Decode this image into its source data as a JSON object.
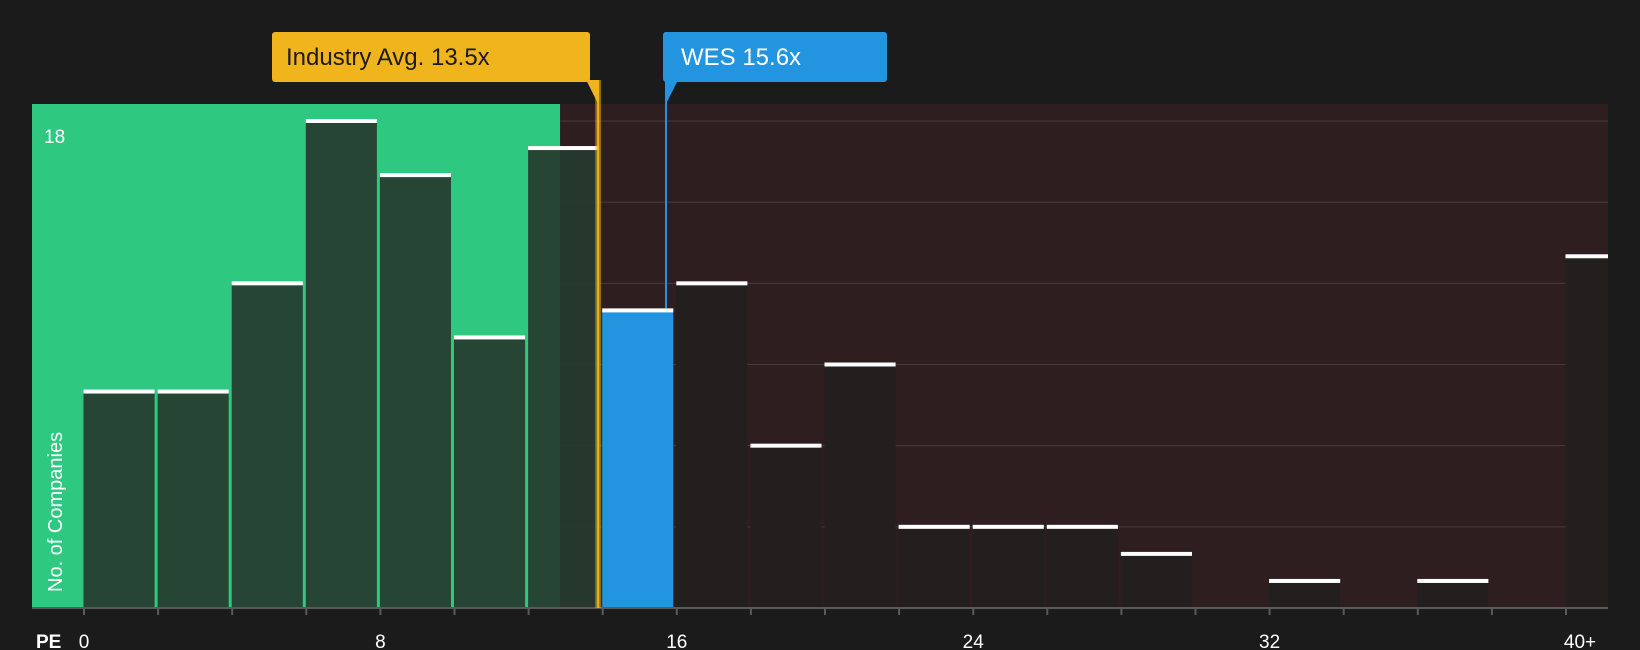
{
  "chart_data": {
    "type": "bar",
    "title": "",
    "xlabel": "PE",
    "ylabel": "No. of Companies",
    "x_tick_labels": [
      "0",
      "8",
      "16",
      "24",
      "32",
      "40+"
    ],
    "x_tick_values": [
      0,
      8,
      16,
      24,
      32,
      40
    ],
    "y_tick_labels": [
      "18"
    ],
    "y_tick_values": [
      18
    ],
    "ylim": [
      0,
      18.7
    ],
    "xlim": [
      -1.4,
      41.0
    ],
    "bin_width": 2,
    "bins": [
      {
        "start": 0,
        "end": 2,
        "value": 8
      },
      {
        "start": 2,
        "end": 4,
        "value": 8
      },
      {
        "start": 4,
        "end": 6,
        "value": 12
      },
      {
        "start": 6,
        "end": 8,
        "value": 18
      },
      {
        "start": 8,
        "end": 10,
        "value": 16
      },
      {
        "start": 10,
        "end": 12,
        "value": 10
      },
      {
        "start": 12,
        "end": 14,
        "value": 17
      },
      {
        "start": 14,
        "end": 16,
        "value": 11
      },
      {
        "start": 16,
        "end": 18,
        "value": 12
      },
      {
        "start": 18,
        "end": 20,
        "value": 6
      },
      {
        "start": 20,
        "end": 22,
        "value": 9
      },
      {
        "start": 22,
        "end": 24,
        "value": 3
      },
      {
        "start": 24,
        "end": 26,
        "value": 3
      },
      {
        "start": 26,
        "end": 28,
        "value": 3
      },
      {
        "start": 28,
        "end": 30,
        "value": 2
      },
      {
        "start": 30,
        "end": 32,
        "value": 0
      },
      {
        "start": 32,
        "end": 34,
        "value": 1
      },
      {
        "start": 34,
        "end": 36,
        "value": 0
      },
      {
        "start": 36,
        "end": 38,
        "value": 1
      },
      {
        "start": 38,
        "end": 40,
        "value": 0
      },
      {
        "start": 40,
        "end": 42,
        "value": 13
      }
    ],
    "highlight_bin_start": 14,
    "undervalued_region_end": 13.5,
    "industry_avg": {
      "value": 13.5,
      "label": "Industry Avg. 13.5x"
    },
    "company": {
      "value": 15.6,
      "label": "WES 15.6x"
    },
    "grid": true,
    "colors": {
      "background": "#1b1b1b",
      "undervalued_region": "#2fc880",
      "overvalued_region": "#2e1e1f",
      "bar_dark": "#26392f",
      "bar_overvalued": "#241f1f",
      "highlight_bar": "#2394e0",
      "industry_marker": "#f0b41c",
      "company_marker": "#2394e0",
      "bar_cap": "#ffffff",
      "gridline": "#4a3a3b",
      "axis": "#5a5a5a"
    }
  }
}
